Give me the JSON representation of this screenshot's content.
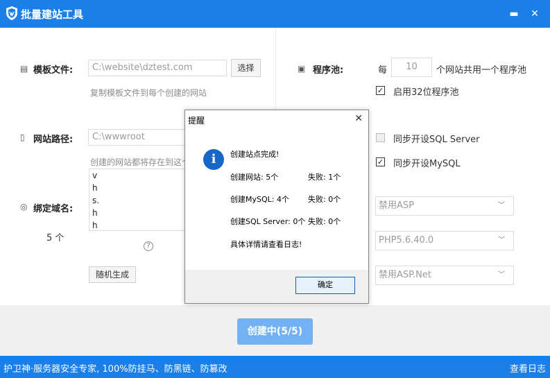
{
  "window": {
    "title": "批量建站工具",
    "minimize": "▬",
    "close": "✕"
  },
  "template": {
    "label": "模板文件:",
    "value": "C:\\website\\dztest.com",
    "choose": "选择",
    "hint": "复制模板文件到每个创建的网站"
  },
  "site_path": {
    "label": "网站路径:",
    "value": "C:\\wwwroot",
    "hint": "创建的网站都将存在到这个"
  },
  "domains": {
    "label": "绑定域名:",
    "count": "5 个",
    "lines": [
      "v",
      "h",
      "s.",
      "h",
      "h"
    ],
    "random_button": "随机生成",
    "help": "?"
  },
  "app_pool": {
    "label": "程序池:",
    "prefix": "每",
    "value": "10",
    "suffix": "个网站共用一个程序池",
    "enable32": "启用32位程序池",
    "enable32_checked": true
  },
  "sync": {
    "sql_server": "同步开设SQL Server",
    "sql_server_checked": false,
    "mysql": "同步开设MySQL",
    "mysql_checked": true
  },
  "selects": {
    "asp": "禁用ASP",
    "php": "PHP5.6.40.0",
    "aspnet": "禁用ASP.Net"
  },
  "create_button": "创建中(5/5)",
  "dialog": {
    "title": "提醒",
    "close": "✕",
    "icon_glyph": "i",
    "complete": "创建站点完成!",
    "site_created": "创建网站: 5个",
    "site_failed": "失败: 1个",
    "mysql_created": "创建MySQL: 4个",
    "mysql_failed": "失败: 0个",
    "sql_created": "创建SQL Server: 0个",
    "sql_failed": "失败: 0个",
    "see_log": "具体详情请查看日志!",
    "ok": "确定"
  },
  "statusbar": {
    "left": "护卫神·服务器安全专家, 100%防挂马、防黑链、防篡改",
    "right": "查看日志"
  },
  "colors": {
    "brand": "#1a7fe8",
    "primary_disabled": "#72b2f3",
    "info_icon": "#1667c8"
  }
}
